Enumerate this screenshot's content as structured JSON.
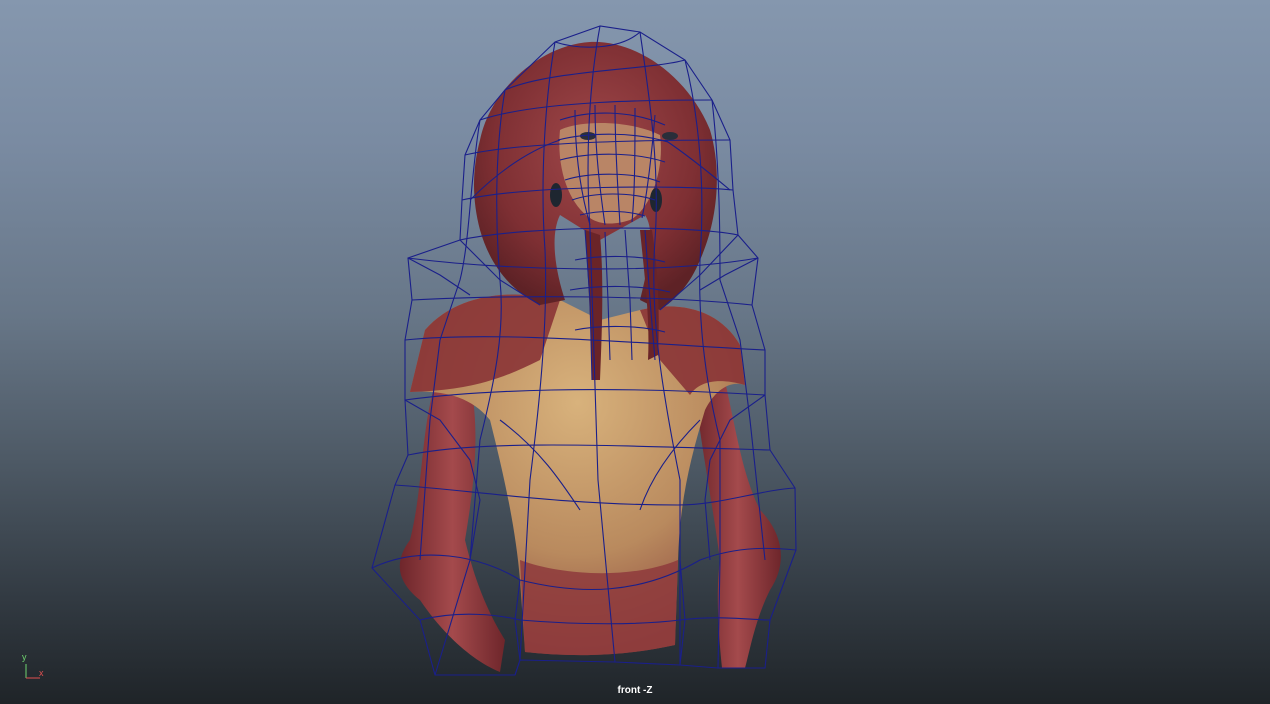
{
  "viewport": {
    "camera_label": "front -Z",
    "background_top": "#8597ae",
    "background_bottom": "#1f2428",
    "wireframe_color": "#1a1f8a"
  },
  "axis_gizmo": {
    "y_label": "y",
    "x_label": "x",
    "y_color": "#6fd36f",
    "x_color": "#e05050"
  },
  "model": {
    "icon": "creature-bust-model",
    "skin_color": "#8a3a3c",
    "chest_color": "#c9a070"
  }
}
